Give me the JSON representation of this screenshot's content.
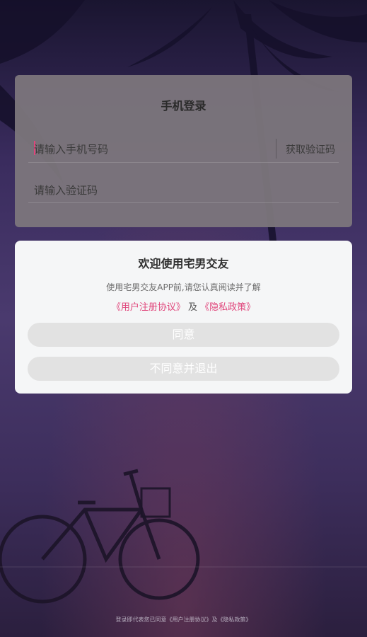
{
  "login": {
    "title": "手机登录",
    "phone_placeholder": "请输入手机号码",
    "get_code": "获取验证码",
    "code_placeholder": "请输入验证码"
  },
  "modal": {
    "title": "欢迎使用宅男交友",
    "text": "使用宅男交友APP前,请您认真阅读并了解",
    "user_agreement": "《用户注册协议》",
    "and": "及",
    "privacy_policy": "《隐私政策》",
    "agree_label": "同意",
    "disagree_label": "不同意并退出"
  },
  "footer": {
    "text": "登录即代表您已同意《用户注册协议》及《隐私政策》"
  },
  "colors": {
    "accent": "#e0457b",
    "button_bg": "#e2e2e2"
  }
}
